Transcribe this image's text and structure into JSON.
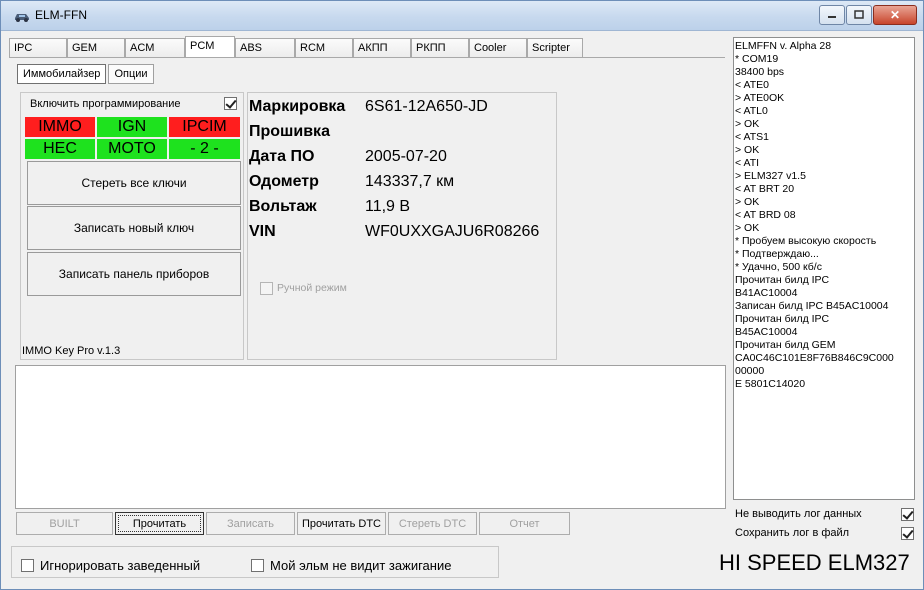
{
  "window": {
    "title": "ELM-FFN"
  },
  "tabs": [
    "IPC",
    "GEM",
    "ACM",
    "PCM",
    "ABS",
    "RCM",
    "АКПП",
    "РКПП",
    "Cooler",
    "Scripter"
  ],
  "active_tab": "PCM",
  "subtabs": [
    "Иммобилайзер",
    "Опции"
  ],
  "immo": {
    "enable_label": "Включить программирование",
    "enable_checked": true,
    "status": [
      "IMMO",
      "IGN",
      "IPCIM",
      "HEC",
      "MOTO",
      "- 2 -"
    ],
    "status_colors": [
      "#ff1e1e",
      "#1ee21e",
      "#ff1e1e",
      "#1ee21e",
      "#1ee21e",
      "#1ee21e"
    ],
    "buttons": [
      "Стереть все ключи",
      "Записать новый ключ",
      "Записать панель приборов"
    ],
    "version": "IMMO Key Pro v.1.3"
  },
  "info": {
    "labels": [
      "Маркировка",
      "Прошивка",
      "Дата ПО",
      "Одометр",
      "Вольтаж",
      "VIN"
    ],
    "values": [
      "6S61-12A650-JD",
      "",
      "2005-07-20",
      "143337,7 км",
      "11,9 В",
      "WF0UXXGAJU6R08266"
    ],
    "manual_mode_label": "Ручной режим"
  },
  "action_buttons": {
    "built": "BUILT",
    "read": "Прочитать",
    "write": "Записать",
    "read_dtc": "Прочитать DTC",
    "clear_dtc": "Стереть DTC",
    "report": "Отчет"
  },
  "bottom": {
    "ignore_running": "Игнорировать заведенный",
    "no_ignition": "Мой эльм не видит зажигание",
    "speed": "HI SPEED ELM327"
  },
  "log": {
    "lines": [
      "ELMFFN v. Alpha 28",
      "* COM19",
      "38400 bps",
      "< ATE0",
      "> ATE0OK",
      "< ATL0",
      "> OK",
      "< ATS1",
      "> OK",
      "< ATI",
      "> ELM327 v1.5",
      "< AT BRT 20",
      "> OK",
      "< AT BRD 08",
      "> OK",
      "* Пробуем высокую скорость",
      "* Подтверждаю...",
      "* Удачно, 500 кб/с",
      "Прочитан билд IPC",
      "B41AC10004",
      "Записан билд IPC B45AC10004",
      "Прочитан билд IPC",
      "B45AC10004",
      "Прочитан билд GEM",
      "CA0C46C101E8F76B846C9C000",
      "00000",
      "E 5801C14020"
    ],
    "no_output_label": "Не выводить лог данных",
    "no_output_checked": true,
    "save_label": "Сохранить лог в файл",
    "save_checked": true
  }
}
